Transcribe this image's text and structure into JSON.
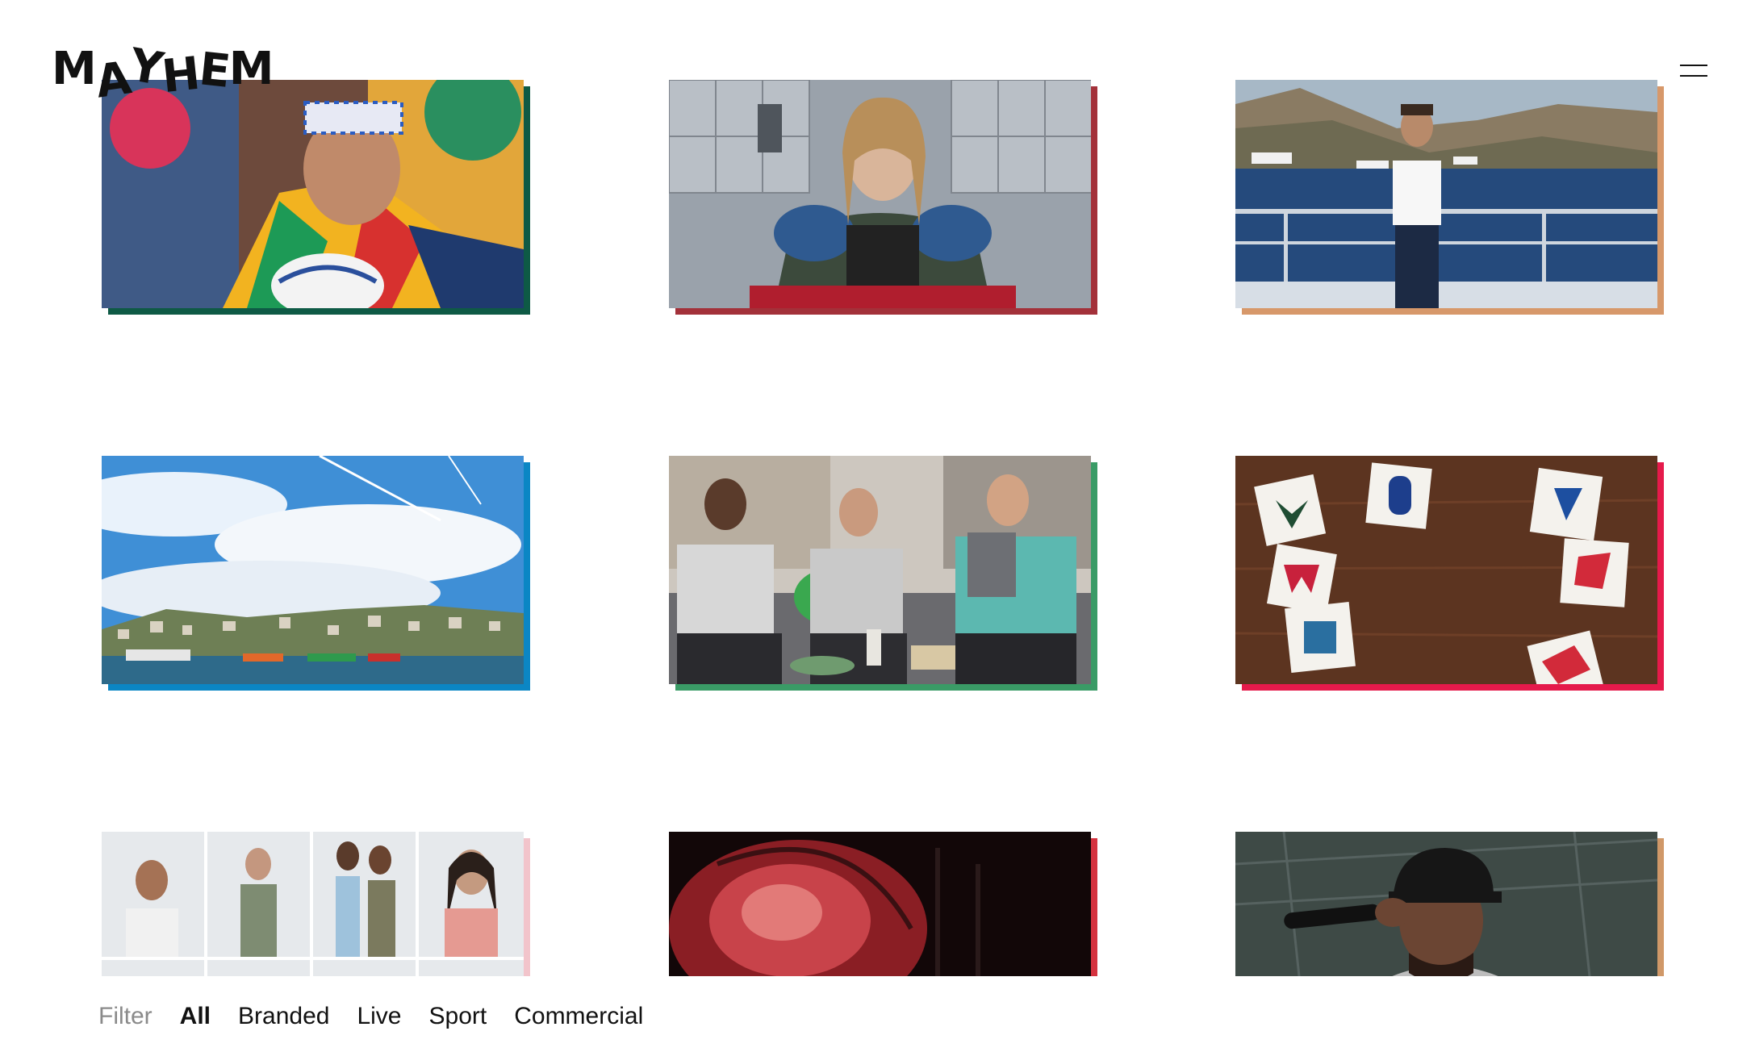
{
  "brand": {
    "logo_letters": [
      "M",
      "A",
      "Y",
      "H",
      "E",
      "M"
    ]
  },
  "menu": {
    "icon": "hamburger-menu-icon"
  },
  "tiles": [
    {
      "name": "tile-rugby-veteran",
      "accent": "#0e5a45",
      "scene": "rugby player in argyle shirt with headband"
    },
    {
      "name": "tile-armored-woman",
      "accent": "#a3313a",
      "scene": "woman wearing body armour in locker room"
    },
    {
      "name": "tile-yacht-man",
      "accent": "#d7986a",
      "scene": "man in white t-shirt on yacht deck by coast"
    },
    {
      "name": "tile-harbour-town",
      "accent": "#0b86c4",
      "scene": "harbour town under blue sky"
    },
    {
      "name": "tile-gamers-sofa",
      "accent": "#3a9b66",
      "scene": "three men playing video games on sofa"
    },
    {
      "name": "tile-team-logos",
      "accent": "#e51a4b",
      "scene": "basketball team logo cards on wooden table"
    },
    {
      "name": "tile-portraits-grid",
      "accent": "#f2c4cb",
      "scene": "grid of studio portraits"
    },
    {
      "name": "tile-concert-stage",
      "accent": "#d5323f",
      "scene": "red lit concert stage"
    },
    {
      "name": "tile-rapper-mic",
      "accent": "#d09868",
      "scene": "performer with microphone"
    }
  ],
  "filter": {
    "label": "Filter",
    "options": [
      "All",
      "Branded",
      "Live",
      "Sport",
      "Commercial"
    ],
    "active": "All"
  }
}
